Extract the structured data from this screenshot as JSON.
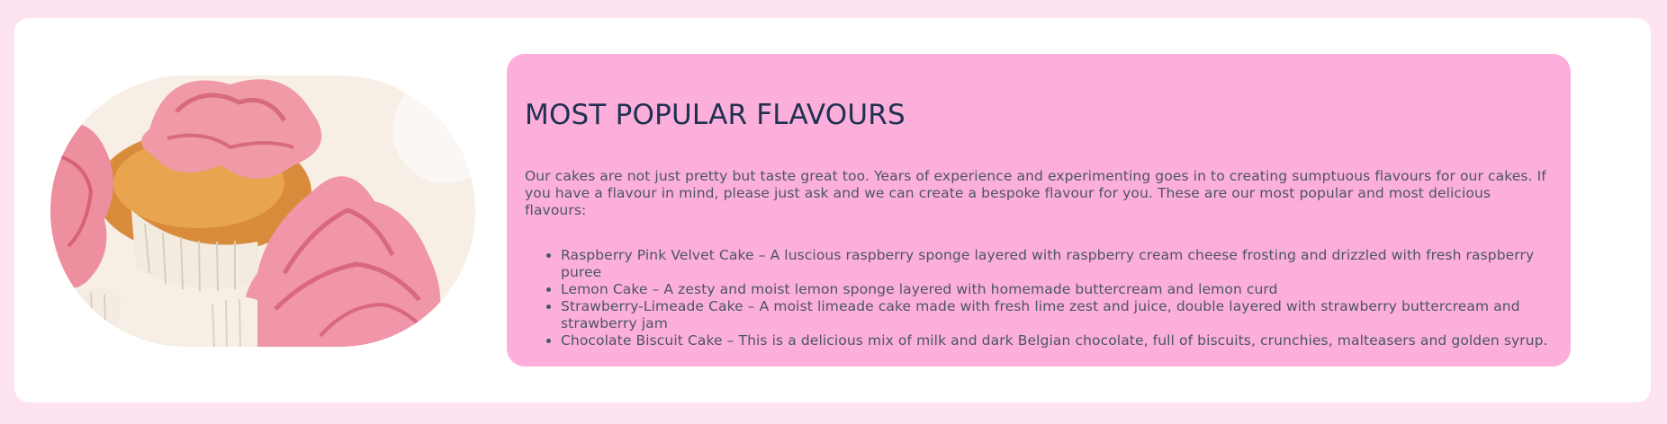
{
  "section": {
    "title": "MOST POPULAR FLAVOURS",
    "intro": "Our cakes are not just pretty but taste great too. Years of experience and experimenting goes in to creating sumptuous flavours for our cakes. If you have a flavour in mind, please just ask and we can create a bespoke flavour for you. These are our most popular and most delicious flavours:",
    "flavours": [
      "Raspberry Pink Velvet Cake – A luscious raspberry sponge layered with raspberry cream cheese frosting and drizzled with fresh raspberry puree",
      "Lemon Cake – A zesty and moist lemon sponge layered with homemade buttercream and lemon curd",
      "Strawberry-Limeade Cake – A moist limeade cake made with fresh lime zest and juice, double layered with strawberry buttercream and strawberry jam",
      "Chocolate Biscuit Cake – This is a delicious mix of milk and dark Belgian chocolate, full of biscuits, crunchies, malteasers and golden syrup."
    ]
  },
  "image": {
    "subject": "pink-frosted-cupcakes"
  },
  "colors": {
    "page_background": "#fde2ef",
    "card_background": "#ffffff",
    "panel_background": "#fdafdc",
    "title_color": "#1f3150",
    "body_text_color": "#4a5465"
  }
}
